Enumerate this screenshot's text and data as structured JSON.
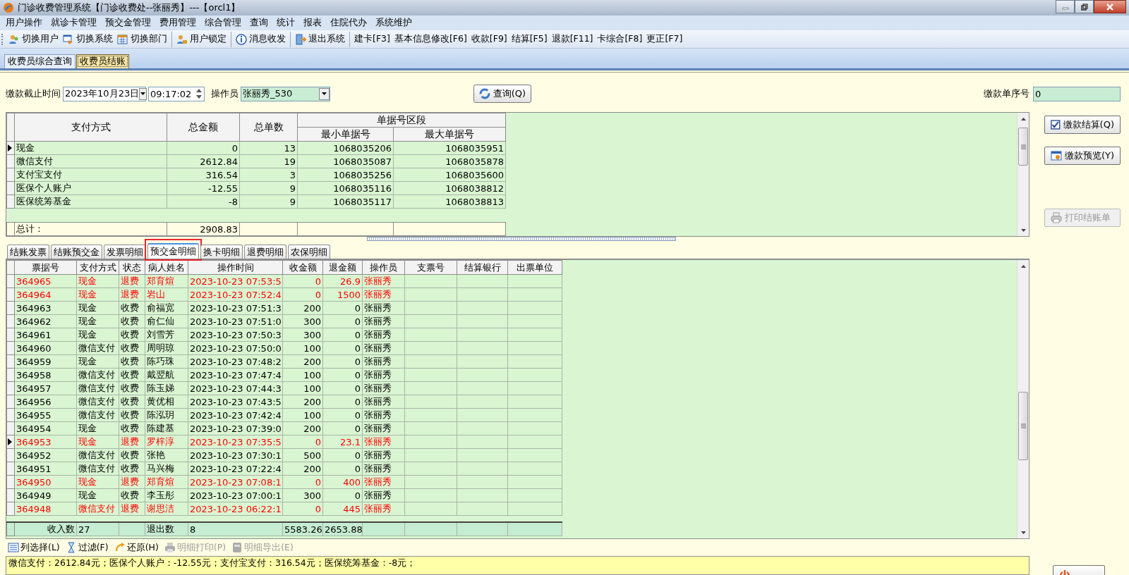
{
  "window": {
    "title": "门诊收费管理系统【门诊收费处--张丽秀】---【orcl1】"
  },
  "menu": [
    "用户操作",
    "就诊卡管理",
    "预交金管理",
    "费用管理",
    "综合管理",
    "查询",
    "统计",
    "报表",
    "住院代办",
    "系统维护"
  ],
  "toolbar": [
    {
      "label": "切换用户",
      "kind": "icon",
      "separator_before": false
    },
    {
      "label": "切换系统",
      "kind": "icon",
      "separator_before": false
    },
    {
      "label": "切换部门",
      "kind": "icon",
      "separator_before": false
    },
    {
      "label": "用户锁定",
      "kind": "icon",
      "separator_before": true
    },
    {
      "label": "消息收发",
      "kind": "icon",
      "separator_before": true
    },
    {
      "label": "退出系统",
      "kind": "icon",
      "separator_before": true
    },
    {
      "label": "建卡[F3]",
      "kind": "text",
      "separator_before": true
    },
    {
      "label": "基本信息修改[F6]",
      "kind": "text",
      "separator_before": false
    },
    {
      "label": "收款[F9]",
      "kind": "text",
      "separator_before": false
    },
    {
      "label": "结算[F5]",
      "kind": "text",
      "separator_before": false
    },
    {
      "label": "退款[F11]",
      "kind": "text",
      "separator_before": false
    },
    {
      "label": "卡综合[F8]",
      "kind": "text",
      "separator_before": false
    },
    {
      "label": "更正[F7]",
      "kind": "text",
      "separator_before": false
    }
  ],
  "page_tabs": [
    {
      "label": "收费员综合查询",
      "selected": false
    },
    {
      "label": "收费员结账",
      "selected": true
    }
  ],
  "query": {
    "cutoff_label": "缴款截止时间",
    "date": "2023年10月23日",
    "time": "09:17:02",
    "operator_label": "操作员",
    "operator": "张丽秀_530",
    "query_button": "查询(Q)",
    "serial_label": "缴款单序号",
    "serial": "0"
  },
  "summary_table": {
    "columns": [
      "支付方式",
      "总金额",
      "总单数"
    ],
    "group_header": "单据号区段",
    "group_columns": [
      "最小单据号",
      "最大单据号"
    ],
    "rows": [
      {
        "cells": [
          "现金",
          "0",
          "13",
          "1068035206",
          "1068035951"
        ],
        "selected": true
      },
      {
        "cells": [
          "微信支付",
          "2612.84",
          "19",
          "1068035087",
          "1068035878"
        ],
        "selected": false
      },
      {
        "cells": [
          "支付宝支付",
          "316.54",
          "3",
          "1068035256",
          "1068035600"
        ],
        "selected": false
      },
      {
        "cells": [
          "医保个人账户",
          "-12.55",
          "9",
          "1068035116",
          "1068038812"
        ],
        "selected": false
      },
      {
        "cells": [
          "医保统筹基金",
          "-8",
          "9",
          "1068035117",
          "1068038813"
        ],
        "selected": false
      }
    ],
    "total_label": "总计：",
    "total_amount": "2908.83"
  },
  "side_buttons": [
    {
      "label": "缴款结算(Q)",
      "disabled": false
    },
    {
      "label": "缴款预览(Y)",
      "disabled": false
    },
    {
      "label": "打印结账单",
      "disabled": true
    }
  ],
  "detail_tabs": [
    {
      "label": "结账发票",
      "selected": false,
      "highlighted": false
    },
    {
      "label": "结账预交金",
      "selected": false,
      "highlighted": false
    },
    {
      "label": "发票明细",
      "selected": false,
      "highlighted": false
    },
    {
      "label": "预交金明细",
      "selected": true,
      "highlighted": true
    },
    {
      "label": "换卡明细",
      "selected": false,
      "highlighted": false
    },
    {
      "label": "退费明细",
      "selected": false,
      "highlighted": false
    },
    {
      "label": "农保明细",
      "selected": false,
      "highlighted": false
    }
  ],
  "detail_table": {
    "columns": [
      "票据号",
      "支付方式",
      "状态",
      "病人姓名",
      "操作时间",
      "收金额",
      "退金额",
      "操作员",
      "支票号",
      "结算银行",
      "出票单位"
    ],
    "rows": [
      {
        "cells": [
          "364965",
          "现金",
          "退费",
          "郑育煊",
          "2023-10-23 07:53:5",
          "0",
          "26.9",
          "张丽秀"
        ],
        "refund": true,
        "selected": false
      },
      {
        "cells": [
          "364964",
          "现金",
          "退费",
          "岩山",
          "2023-10-23 07:52:4",
          "0",
          "1500",
          "张丽秀"
        ],
        "refund": true,
        "selected": false
      },
      {
        "cells": [
          "364963",
          "现金",
          "收费",
          "俞福宽",
          "2023-10-23 07:51:3",
          "200",
          "0",
          "张丽秀"
        ],
        "refund": false,
        "selected": false
      },
      {
        "cells": [
          "364962",
          "现金",
          "收费",
          "俞仁仙",
          "2023-10-23 07:51:0",
          "300",
          "0",
          "张丽秀"
        ],
        "refund": false,
        "selected": false
      },
      {
        "cells": [
          "364961",
          "现金",
          "收费",
          "刘雪芳",
          "2023-10-23 07:50:3",
          "300",
          "0",
          "张丽秀"
        ],
        "refund": false,
        "selected": false
      },
      {
        "cells": [
          "364960",
          "微信支付",
          "收费",
          "周明琼",
          "2023-10-23 07:50:0",
          "100",
          "0",
          "张丽秀"
        ],
        "refund": false,
        "selected": false
      },
      {
        "cells": [
          "364959",
          "现金",
          "收费",
          "陈巧珠",
          "2023-10-23 07:48:2",
          "200",
          "0",
          "张丽秀"
        ],
        "refund": false,
        "selected": false
      },
      {
        "cells": [
          "364958",
          "微信支付",
          "收费",
          "戴翌航",
          "2023-10-23 07:47:4",
          "100",
          "0",
          "张丽秀"
        ],
        "refund": false,
        "selected": false
      },
      {
        "cells": [
          "364957",
          "微信支付",
          "收费",
          "陈玉娣",
          "2023-10-23 07:44:3",
          "100",
          "0",
          "张丽秀"
        ],
        "refund": false,
        "selected": false
      },
      {
        "cells": [
          "364956",
          "微信支付",
          "收费",
          "黄优相",
          "2023-10-23 07:43:5",
          "200",
          "0",
          "张丽秀"
        ],
        "refund": false,
        "selected": false
      },
      {
        "cells": [
          "364955",
          "微信支付",
          "收费",
          "陈泓玥",
          "2023-10-23 07:42:4",
          "100",
          "0",
          "张丽秀"
        ],
        "refund": false,
        "selected": false
      },
      {
        "cells": [
          "364954",
          "现金",
          "收费",
          "陈建基",
          "2023-10-23 07:39:0",
          "200",
          "0",
          "张丽秀"
        ],
        "refund": false,
        "selected": false
      },
      {
        "cells": [
          "364953",
          "现金",
          "退费",
          "罗梓淳",
          "2023-10-23 07:35:5",
          "0",
          "23.1",
          "张丽秀"
        ],
        "refund": true,
        "selected": true
      },
      {
        "cells": [
          "364952",
          "微信支付",
          "收费",
          "张艳",
          "2023-10-23 07:30:1",
          "500",
          "0",
          "张丽秀"
        ],
        "refund": false,
        "selected": false
      },
      {
        "cells": [
          "364951",
          "微信支付",
          "收费",
          "马兴梅",
          "2023-10-23 07:22:4",
          "200",
          "0",
          "张丽秀"
        ],
        "refund": false,
        "selected": false
      },
      {
        "cells": [
          "364950",
          "现金",
          "退费",
          "郑育煊",
          "2023-10-23 07:08:1",
          "0",
          "400",
          "张丽秀"
        ],
        "refund": true,
        "selected": false
      },
      {
        "cells": [
          "364949",
          "现金",
          "收费",
          "李玉彤",
          "2023-10-23 07:00:1",
          "300",
          "0",
          "张丽秀"
        ],
        "refund": false,
        "selected": false
      },
      {
        "cells": [
          "364948",
          "微信支付",
          "退费",
          "谢思洁",
          "2023-10-23 06:22:1",
          "0",
          "445",
          "张丽秀"
        ],
        "refund": true,
        "selected": false
      }
    ],
    "totals": {
      "income_label": "收入数",
      "income_count": "27",
      "refund_label": "退出数",
      "refund_count": "8",
      "charged_total": "5583.26",
      "refunded_total": "2653.88"
    }
  },
  "grid_toolbar": [
    {
      "label": "列选择(L)",
      "disabled": false
    },
    {
      "label": "过滤(F)",
      "disabled": false
    },
    {
      "label": "还原(H)",
      "disabled": false
    },
    {
      "label": "明细打印(P)",
      "disabled": true
    },
    {
      "label": "明细导出(E)",
      "disabled": true
    }
  ],
  "status_text": "微信支付：2612.84元；医保个人账户：-12.55元；支付宝支付：316.54元；医保统筹基金：-8元；"
}
